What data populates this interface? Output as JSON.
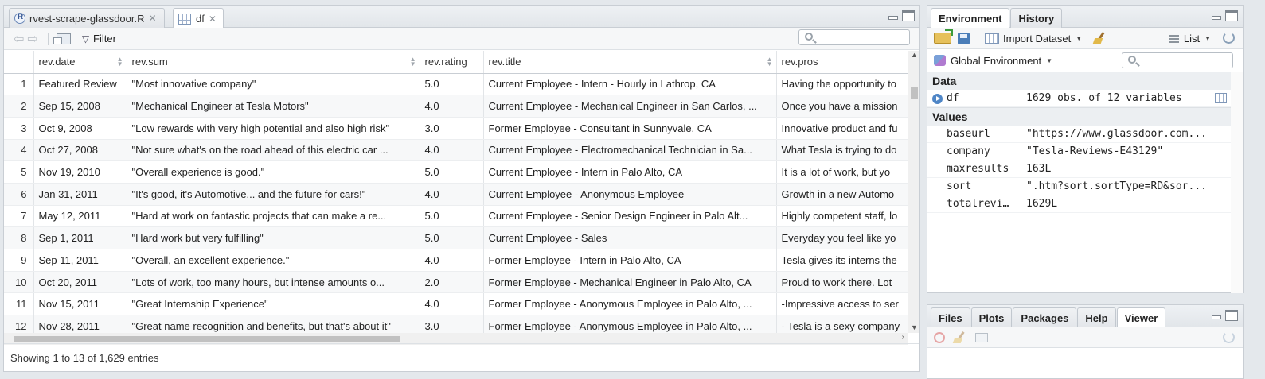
{
  "source_tabs": [
    {
      "label": "rvest-scrape-glassdoor.R",
      "icon": "r-file-icon",
      "active": false
    },
    {
      "label": "df",
      "icon": "table-icon",
      "active": true
    }
  ],
  "toolbar": {
    "filter_label": "Filter",
    "search_placeholder": ""
  },
  "grid": {
    "columns": [
      "rev.date",
      "rev.sum",
      "rev.rating",
      "rev.title",
      "rev.pros"
    ],
    "rows": [
      {
        "n": "1",
        "date": "Featured Review",
        "sum": "\"Most innovative company\"",
        "rating": "5.0",
        "title": "Current Employee - Intern - Hourly in Lathrop, CA",
        "pros": "Having the opportunity to"
      },
      {
        "n": "2",
        "date": "Sep 15, 2008",
        "sum": "\"Mechanical Engineer at Tesla Motors\"",
        "rating": "4.0",
        "title": "Current Employee - Mechanical Engineer in San Carlos, ...",
        "pros": "Once you have a mission"
      },
      {
        "n": "3",
        "date": "Oct 9, 2008",
        "sum": "\"Low rewards with very high potential and also high risk\"",
        "rating": "3.0",
        "title": "Former Employee - Consultant in Sunnyvale, CA",
        "pros": "Innovative product and fu"
      },
      {
        "n": "4",
        "date": "Oct 27, 2008",
        "sum": "\"Not sure what's on the road ahead of this electric car ...",
        "rating": "4.0",
        "title": "Current Employee - Electromechanical Technician in Sa...",
        "pros": "What Tesla is trying to do"
      },
      {
        "n": "5",
        "date": "Nov 19, 2010",
        "sum": "\"Overall experience is good.\"",
        "rating": "5.0",
        "title": "Current Employee - Intern in Palo Alto, CA",
        "pros": "It is a lot of work, but yo"
      },
      {
        "n": "6",
        "date": "Jan 31, 2011",
        "sum": "\"It's good, it's Automotive... and the future for cars!\"",
        "rating": "4.0",
        "title": "Current Employee - Anonymous Employee",
        "pros": "Growth in a new Automo"
      },
      {
        "n": "7",
        "date": "May 12, 2011",
        "sum": "\"Hard at work on fantastic projects that can make a re...",
        "rating": "5.0",
        "title": "Current Employee - Senior Design Engineer in Palo Alt...",
        "pros": "Highly competent staff, lo"
      },
      {
        "n": "8",
        "date": "Sep 1, 2011",
        "sum": "\"Hard work but very fulfilling\"",
        "rating": "5.0",
        "title": "Current Employee - Sales",
        "pros": "Everyday you feel like yo"
      },
      {
        "n": "9",
        "date": "Sep 11, 2011",
        "sum": "\"Overall, an excellent experience.\"",
        "rating": "4.0",
        "title": "Former Employee - Intern in Palo Alto, CA",
        "pros": "Tesla gives its interns the"
      },
      {
        "n": "10",
        "date": "Oct 20, 2011",
        "sum": "\"Lots of work, too many hours, but intense amounts o...",
        "rating": "2.0",
        "title": "Former Employee - Mechanical Engineer in Palo Alto, CA",
        "pros": "Proud to work there. Lot"
      },
      {
        "n": "11",
        "date": "Nov 15, 2011",
        "sum": "\"Great Internship Experience\"",
        "rating": "4.0",
        "title": "Former Employee - Anonymous Employee in Palo Alto, ...",
        "pros": "-Impressive access to ser"
      },
      {
        "n": "12",
        "date": "Nov 28, 2011",
        "sum": "\"Great name recognition and benefits, but that's about it\"",
        "rating": "3.0",
        "title": "Former Employee - Anonymous Employee in Palo Alto, ...",
        "pros": "- Tesla is a sexy company"
      }
    ]
  },
  "status_text": "Showing 1 to 13 of 1,629 entries",
  "env_pane": {
    "tabs": [
      "Environment",
      "History"
    ],
    "import_label": "Import Dataset",
    "list_label": "List",
    "env_selector": "Global Environment",
    "data_header": "Data",
    "values_header": "Values",
    "data_items": [
      {
        "name": "df",
        "value": "1629 obs. of 12 variables"
      }
    ],
    "value_items": [
      {
        "name": "baseurl",
        "value": "\"https://www.glassdoor.com..."
      },
      {
        "name": "company",
        "value": "\"Tesla-Reviews-E43129\""
      },
      {
        "name": "maxresults",
        "value": "163L"
      },
      {
        "name": "sort",
        "value": "\".htm?sort.sortType=RD&sor..."
      },
      {
        "name": "totalrevi…",
        "value": "1629L"
      }
    ]
  },
  "files_pane": {
    "tabs": [
      "Files",
      "Plots",
      "Packages",
      "Help",
      "Viewer"
    ],
    "active_tab": "Viewer"
  }
}
